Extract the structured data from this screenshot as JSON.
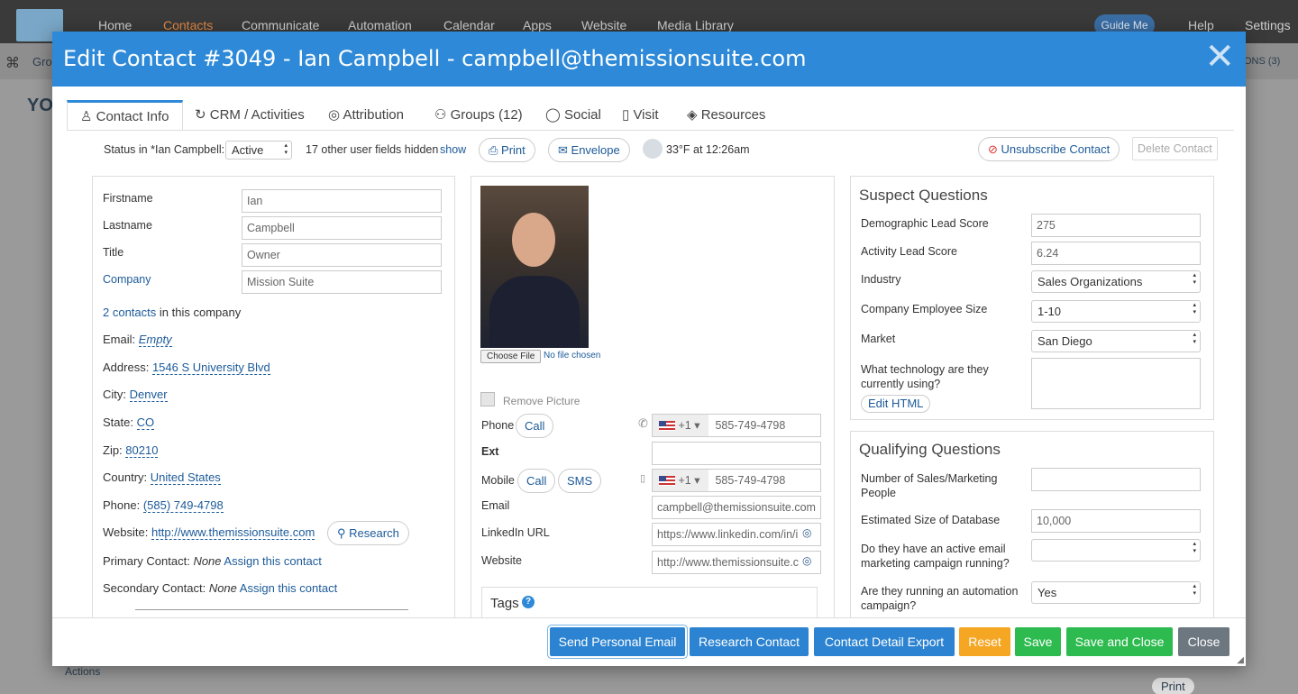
{
  "topnav": {
    "items": [
      "Home",
      "Contacts",
      "Communicate",
      "Automation",
      "Calendar",
      "Apps",
      "Website",
      "Media Library"
    ],
    "active": "Contacts",
    "guide": "Guide Me",
    "help": "Help",
    "settings": "Settings"
  },
  "background": {
    "grou": "Grou",
    "yo": "YO",
    "ons": "ONS (3)",
    "actions": "Actions",
    "print": "Print"
  },
  "modal": {
    "title": "Edit Contact #3049 - Ian Campbell - campbell@themissionsuite.com",
    "close": "✕"
  },
  "tabs": [
    {
      "label": "Contact Info"
    },
    {
      "label": "CRM / Activities"
    },
    {
      "label": "Attribution"
    },
    {
      "label": "Groups (12)"
    },
    {
      "label": "Social"
    },
    {
      "label": "Visit"
    },
    {
      "label": "Resources"
    }
  ],
  "toolbar": {
    "status_label": "Status in *Ian Campbell:",
    "status_value": "Active",
    "hidden_text": "17 other user fields hidden",
    "show": "show",
    "print": "Print",
    "envelope": "Envelope",
    "weather": "33°F at 12:26am",
    "unsubscribe": "Unsubscribe Contact",
    "delete": "Delete Contact"
  },
  "left": {
    "firstname_label": "Firstname",
    "firstname": "Ian",
    "lastname_label": "Lastname",
    "lastname": "Campbell",
    "title_label": "Title",
    "title": "Owner",
    "company_label": "Company",
    "company": "Mission Suite",
    "contacts_link": "2 contacts",
    "contacts_rest": "in this company",
    "email_label": "Email:",
    "email": "Empty",
    "address_label": "Address:",
    "address": "1546 S University Blvd",
    "city_label": "City:",
    "city": "Denver",
    "state_label": "State:",
    "state": "CO",
    "zip_label": "Zip:",
    "zip": "80210",
    "country_label": "Country:",
    "country": "United States",
    "phone_label": "Phone:",
    "phone": "(585) 749-4798",
    "website_label": "Website:",
    "website": "http://www.themissionsuite.com",
    "research": "Research",
    "primary_label": "Primary Contact:",
    "primary_none": "None",
    "primary_assign": "Assign this contact",
    "secondary_label": "Secondary Contact:",
    "secondary_none": "None",
    "secondary_assign": "Assign this contact"
  },
  "middle": {
    "choose_file": "Choose File",
    "no_file": "No file chosen",
    "remove_picture": "Remove Picture",
    "phone_label": "Phone",
    "call": "Call",
    "code": "+1",
    "phone": "585-749-4798",
    "ext_label": "Ext",
    "mobile_label": "Mobile",
    "sms": "SMS",
    "mobile": "585-749-4798",
    "email_label": "Email",
    "email": "campbell@themissionsuite.com",
    "linkedin_label": "LinkedIn URL",
    "linkedin": "https://www.linkedin.com/in/i",
    "website_label": "Website",
    "website": "http://www.themissionsuite.c",
    "tags": "Tags"
  },
  "suspect": {
    "heading": "Suspect Questions",
    "demo_label": "Demographic Lead Score",
    "demo": "275",
    "activity_label": "Activity Lead Score",
    "activity": "6.24",
    "industry_label": "Industry",
    "industry": "Sales Organizations",
    "size_label": "Company Employee Size",
    "size": "1-10",
    "market_label": "Market",
    "market": "San Diego",
    "tech_label": "What technology are they currently using?",
    "edit_html": "Edit HTML"
  },
  "qualifying": {
    "heading": "Qualifying Questions",
    "sales_label": "Number of Sales/Marketing People",
    "db_label": "Estimated Size of Database",
    "db": "10,000",
    "email_campaign_label": "Do they have an active email marketing campaign running?",
    "automation_label": "Are they running an automation campaign?",
    "automation": "Yes"
  },
  "footer": {
    "send": "Send Personal Email",
    "research": "Research Contact",
    "export": "Contact Detail Export",
    "reset": "Reset",
    "save": "Save",
    "save_close": "Save and Close",
    "close": "Close"
  },
  "colors": {
    "header": "#2e8ad8",
    "send": "#2c83d1",
    "reset": "#f5a623",
    "save": "#2dbb4f",
    "close": "#6d7780"
  }
}
